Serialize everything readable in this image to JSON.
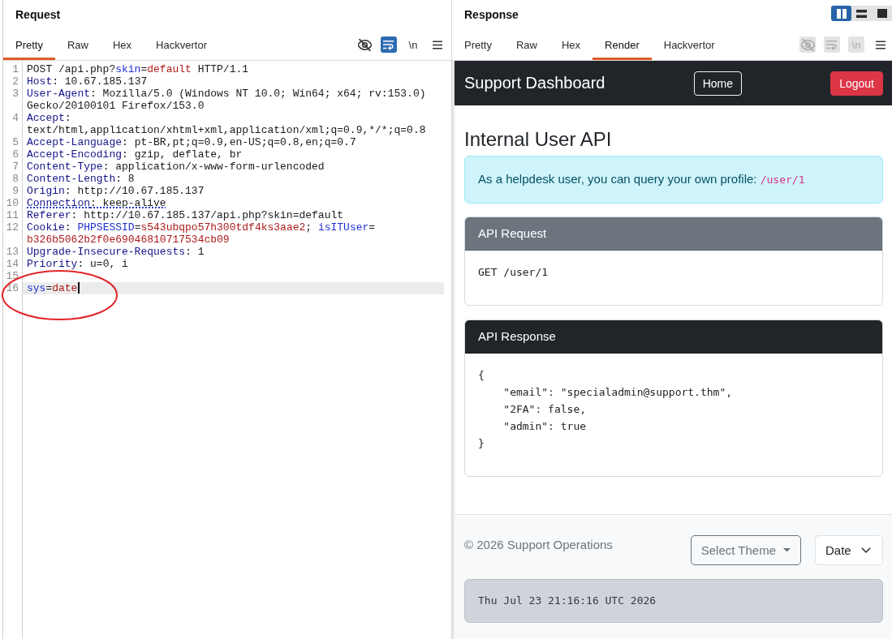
{
  "request": {
    "title": "Request",
    "tabs": [
      {
        "label": "Pretty",
        "selected": true
      },
      {
        "label": "Raw",
        "selected": false
      },
      {
        "label": "Hex",
        "selected": false
      },
      {
        "label": "Hackvertor",
        "selected": false
      }
    ],
    "tools": [
      {
        "kind": "hide",
        "selected": false,
        "disabled": false
      },
      {
        "kind": "wrap",
        "selected": true,
        "disabled": false
      },
      {
        "kind": "newlines",
        "label": "\\n",
        "selected": false,
        "disabled": false
      },
      {
        "kind": "menu",
        "selected": false,
        "disabled": false
      }
    ],
    "lines": [
      {
        "number": "1",
        "selected": false,
        "flagged": false,
        "circled": false,
        "rows": [
          [
            {
              "kind": "plain",
              "text": "POST /api.php?"
            },
            {
              "kind": "param",
              "text": "skin"
            },
            {
              "kind": "plain",
              "text": "="
            },
            {
              "kind": "value",
              "text": "default"
            },
            {
              "kind": "plain",
              "text": " HTTP/1.1"
            }
          ]
        ]
      },
      {
        "number": "2",
        "selected": false,
        "flagged": false,
        "circled": false,
        "rows": [
          [
            {
              "kind": "header",
              "text": "Host"
            },
            {
              "kind": "plain",
              "text": ": 10.67.185.137"
            }
          ]
        ]
      },
      {
        "number": "3",
        "selected": false,
        "flagged": false,
        "circled": false,
        "rows": [
          [
            {
              "kind": "header",
              "text": "User-Agent"
            },
            {
              "kind": "plain",
              "text": ": Mozilla/5.0 (Windows NT 10.0; Win64; x64; rv:153.0)"
            }
          ],
          [
            {
              "kind": "plain",
              "text": "Gecko/20100101 Firefox/153.0"
            }
          ]
        ]
      },
      {
        "number": "4",
        "selected": false,
        "flagged": false,
        "circled": false,
        "rows": [
          [
            {
              "kind": "header",
              "text": "Accept"
            },
            {
              "kind": "plain",
              "text": ":"
            }
          ],
          [
            {
              "kind": "plain",
              "text": "text/html,application/xhtml+xml,application/xml;q=0.9,*/*;q=0.8"
            }
          ]
        ]
      },
      {
        "number": "5",
        "selected": false,
        "flagged": false,
        "circled": false,
        "rows": [
          [
            {
              "kind": "header",
              "text": "Accept-Language"
            },
            {
              "kind": "plain",
              "text": ": pt-BR,pt;q=0.9,en-US;q=0.8,en;q=0.7"
            }
          ]
        ]
      },
      {
        "number": "6",
        "selected": false,
        "flagged": false,
        "circled": false,
        "rows": [
          [
            {
              "kind": "header",
              "text": "Accept-Encoding"
            },
            {
              "kind": "plain",
              "text": ": gzip, deflate, br"
            }
          ]
        ]
      },
      {
        "number": "7",
        "selected": false,
        "flagged": false,
        "circled": false,
        "rows": [
          [
            {
              "kind": "header",
              "text": "Content-Type"
            },
            {
              "kind": "plain",
              "text": ": application/x-www-form-urlencoded"
            }
          ]
        ]
      },
      {
        "number": "8",
        "selected": false,
        "flagged": false,
        "circled": false,
        "rows": [
          [
            {
              "kind": "header",
              "text": "Content-Length"
            },
            {
              "kind": "plain",
              "text": ": 8"
            }
          ]
        ]
      },
      {
        "number": "9",
        "selected": false,
        "flagged": false,
        "circled": false,
        "rows": [
          [
            {
              "kind": "header",
              "text": "Origin"
            },
            {
              "kind": "plain",
              "text": ": http://10.67.185.137"
            }
          ]
        ]
      },
      {
        "number": "10",
        "selected": false,
        "flagged": true,
        "circled": false,
        "rows": [
          [
            {
              "kind": "header",
              "text": "Connection"
            },
            {
              "kind": "plain",
              "text": ": keep-alive"
            }
          ]
        ]
      },
      {
        "number": "11",
        "selected": false,
        "flagged": false,
        "circled": false,
        "rows": [
          [
            {
              "kind": "header",
              "text": "Referer"
            },
            {
              "kind": "plain",
              "text": ": http://10.67.185.137/api.php?skin=default"
            }
          ]
        ]
      },
      {
        "number": "12",
        "selected": false,
        "flagged": false,
        "circled": false,
        "rows": [
          [
            {
              "kind": "header",
              "text": "Cookie"
            },
            {
              "kind": "plain",
              "text": ": "
            },
            {
              "kind": "param",
              "text": "PHPSESSID"
            },
            {
              "kind": "plain",
              "text": "="
            },
            {
              "kind": "value",
              "text": "s543ubqpo57h300tdf4ks3aae2"
            },
            {
              "kind": "plain",
              "text": "; "
            },
            {
              "kind": "param",
              "text": "isITUser"
            },
            {
              "kind": "plain",
              "text": "="
            }
          ],
          [
            {
              "kind": "value",
              "text": "b326b5062b2f0e69046810717534cb09"
            }
          ]
        ]
      },
      {
        "number": "13",
        "selected": false,
        "flagged": false,
        "circled": false,
        "rows": [
          [
            {
              "kind": "header",
              "text": "Upgrade-Insecure-Requests"
            },
            {
              "kind": "plain",
              "text": ": 1"
            }
          ]
        ]
      },
      {
        "number": "14",
        "selected": false,
        "flagged": false,
        "circled": false,
        "rows": [
          [
            {
              "kind": "header",
              "text": "Priority"
            },
            {
              "kind": "plain",
              "text": ": u=0, i"
            }
          ]
        ]
      },
      {
        "number": "15",
        "selected": false,
        "circled": false
      },
      {
        "number": "16",
        "selected": true,
        "flagged": false,
        "circled": true,
        "rows": [
          [
            {
              "kind": "param",
              "text": "sys"
            },
            {
              "kind": "plain",
              "text": "="
            },
            {
              "kind": "value",
              "text": "date"
            }
          ]
        ]
      }
    ]
  },
  "response": {
    "title": "Response",
    "layouts": [
      {
        "kind": "columns",
        "selected": true
      },
      {
        "kind": "rows",
        "selected": false
      },
      {
        "kind": "single",
        "selected": false
      }
    ],
    "tabs": [
      {
        "label": "Pretty",
        "selected": false
      },
      {
        "label": "Raw",
        "selected": false
      },
      {
        "label": "Hex",
        "selected": false
      },
      {
        "label": "Render",
        "selected": true
      },
      {
        "label": "Hackvertor",
        "selected": false
      }
    ],
    "tools": [
      {
        "kind": "hide",
        "selected": false,
        "disabled": true
      },
      {
        "kind": "wrap",
        "selected": false,
        "disabled": true
      },
      {
        "kind": "newlines",
        "label": "\\n",
        "selected": false,
        "disabled": true
      },
      {
        "kind": "menu",
        "selected": false,
        "disabled": false
      }
    ],
    "render": {
      "navbar": {
        "brand": "Support Dashboard",
        "buttons": [
          {
            "kind": "outline",
            "label": "Home"
          },
          {
            "kind": "danger",
            "label": "Logout"
          }
        ]
      },
      "heading": "Internal User API",
      "alert": {
        "text": "As a helpdesk user, you can query your own profile:",
        "code": "/user/1"
      },
      "cards": [
        {
          "kind": "secondary",
          "title": "API Request",
          "lines": [
            "GET /user/1"
          ]
        },
        {
          "kind": "dark",
          "title": "API Response",
          "lines": [
            "{",
            "    \"email\": \"specialadmin@support.thm\",",
            "    \"2FA\": false,",
            "    \"admin\": true",
            "}"
          ]
        }
      ],
      "footer": {
        "copyright": "© 2026 Support Operations",
        "theme_button": "Select Theme",
        "command_select": {
          "value": "Date"
        },
        "output": "Thu Jul 23 21:16:16 UTC 2026"
      }
    }
  }
}
